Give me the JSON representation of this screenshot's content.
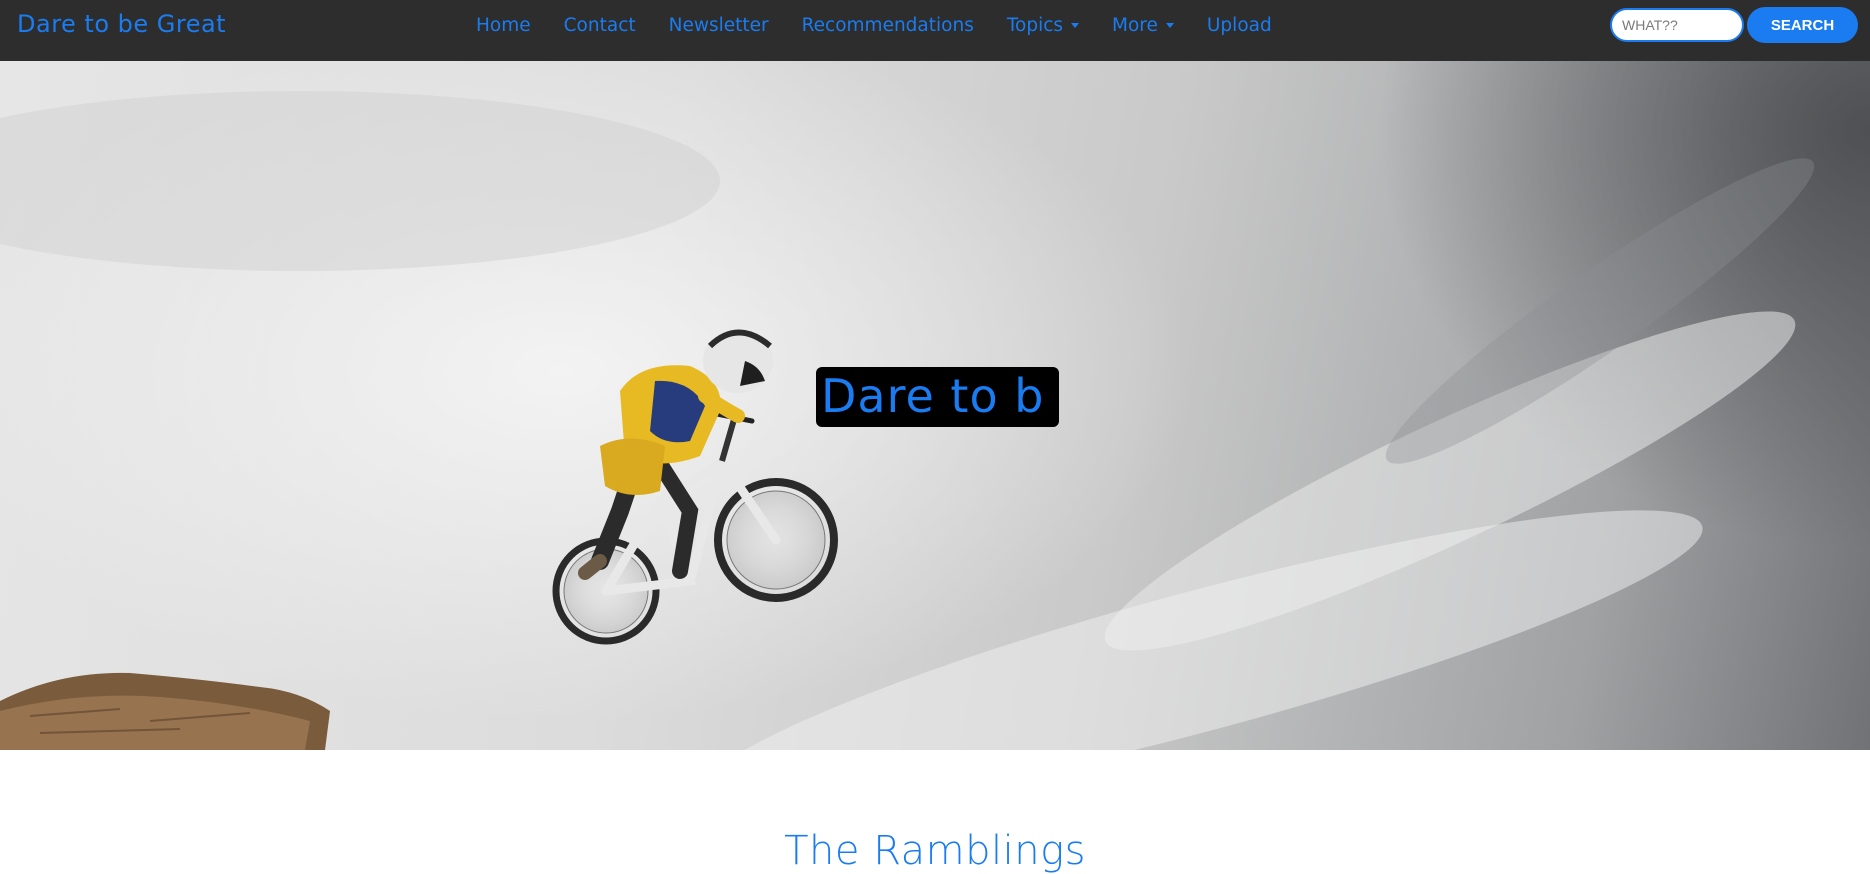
{
  "brand": {
    "label": "Dare to be Great"
  },
  "nav": {
    "items": [
      {
        "label": "Home",
        "dropdown": false
      },
      {
        "label": "Contact",
        "dropdown": false
      },
      {
        "label": "Newsletter",
        "dropdown": false
      },
      {
        "label": "Recommendations",
        "dropdown": false
      },
      {
        "label": "Topics",
        "dropdown": true
      },
      {
        "label": "More",
        "dropdown": true
      },
      {
        "label": "Upload",
        "dropdown": false
      }
    ]
  },
  "search": {
    "placeholder": "WHAT??",
    "value": "",
    "button_label": "SEARCH"
  },
  "hero": {
    "title_text": "Dare to b",
    "image_subject": "mountain biker jumping in cloudy sky"
  },
  "main": {
    "section_heading": "The Ramblings"
  },
  "colors": {
    "accent": "#1a7cf0",
    "navbar_bg": "#2d2d2d",
    "title_box_bg": "#000000"
  },
  "icons": {
    "dropdown": "caret-down-icon"
  }
}
